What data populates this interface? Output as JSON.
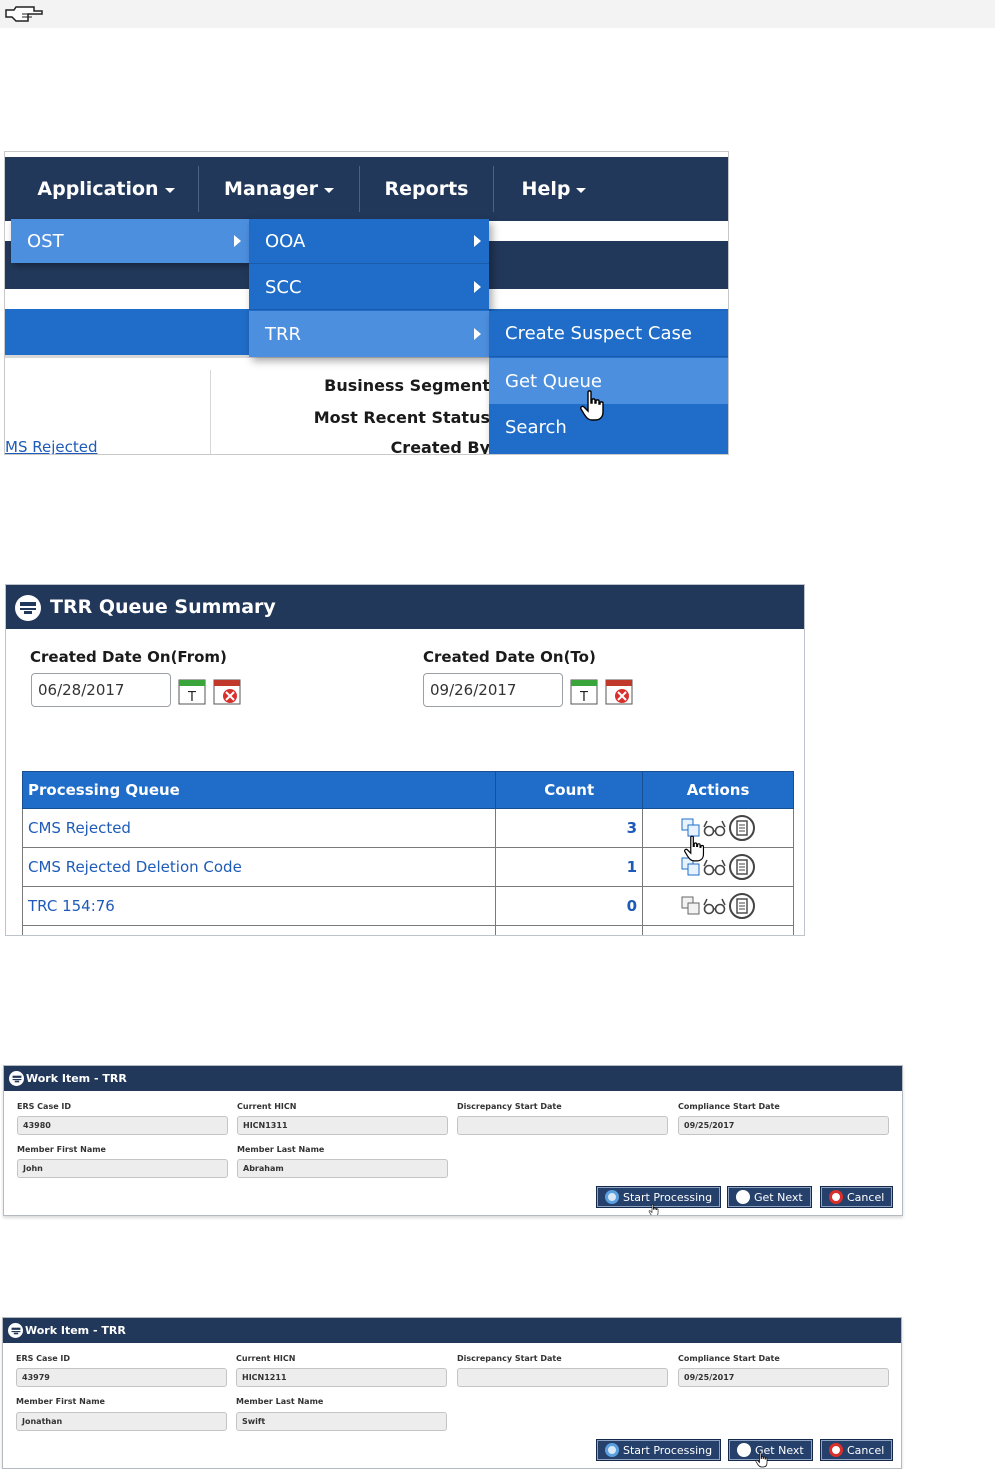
{
  "nav_menu": {
    "top_items": [
      {
        "label": "Application",
        "has_caret": true
      },
      {
        "label": "Manager",
        "has_caret": true
      },
      {
        "label": "Reports",
        "has_caret": false
      },
      {
        "label": "Help",
        "has_caret": true
      }
    ],
    "level1": [
      "OST"
    ],
    "level2": [
      "OOA",
      "SCC",
      "TRR"
    ],
    "level3": [
      "Create Suspect Case",
      "Get Queue",
      "Search"
    ],
    "background": {
      "business_segment_label": "Business Segment",
      "most_recent_status_label": "Most Recent Status",
      "created_by_label": "Created By",
      "rejected_link": "MS Rejected"
    },
    "colors": {
      "navy": "#22385a",
      "menu_blue": "#1f6dc9",
      "highlight_blue": "#4d8fdf"
    }
  },
  "queue_summary": {
    "title": "TRR Queue Summary",
    "from_label": "Created Date On(From)",
    "from_value": "06/28/2017",
    "to_label": "Created Date On(To)",
    "to_value": "09/26/2017",
    "columns": [
      "Processing Queue",
      "Count",
      "Actions"
    ],
    "rows": [
      {
        "name": "CMS Rejected",
        "count": "3"
      },
      {
        "name": "CMS Rejected Deletion Code",
        "count": "1"
      },
      {
        "name": "TRC 154:76",
        "count": "0"
      }
    ]
  },
  "work_items": [
    {
      "title": "Work Item - TRR",
      "fields": {
        "ers_case_id_label": "ERS Case ID",
        "ers_case_id": "43980",
        "current_hicn_label": "Current HICN",
        "current_hicn": "HICN1311",
        "discrepancy_label": "Discrepancy Start Date",
        "discrepancy": "",
        "compliance_label": "Compliance Start Date",
        "compliance": "09/25/2017",
        "first_name_label": "Member First Name",
        "first_name": "John",
        "last_name_label": "Member Last Name",
        "last_name": "Abraham"
      },
      "buttons": {
        "start": "Start Processing",
        "next": "Get Next",
        "cancel": "Cancel"
      }
    },
    {
      "title": "Work Item - TRR",
      "fields": {
        "ers_case_id_label": "ERS Case ID",
        "ers_case_id": "43979",
        "current_hicn_label": "Current HICN",
        "current_hicn": "HICN1211",
        "discrepancy_label": "Discrepancy Start Date",
        "discrepancy": "",
        "compliance_label": "Compliance Start Date",
        "compliance": "09/25/2017",
        "first_name_label": "Member First Name",
        "first_name": "Jonathan",
        "last_name_label": "Member Last Name",
        "last_name": "Swift"
      },
      "buttons": {
        "start": "Start Processing",
        "next": "Get Next",
        "cancel": "Cancel"
      }
    }
  ]
}
